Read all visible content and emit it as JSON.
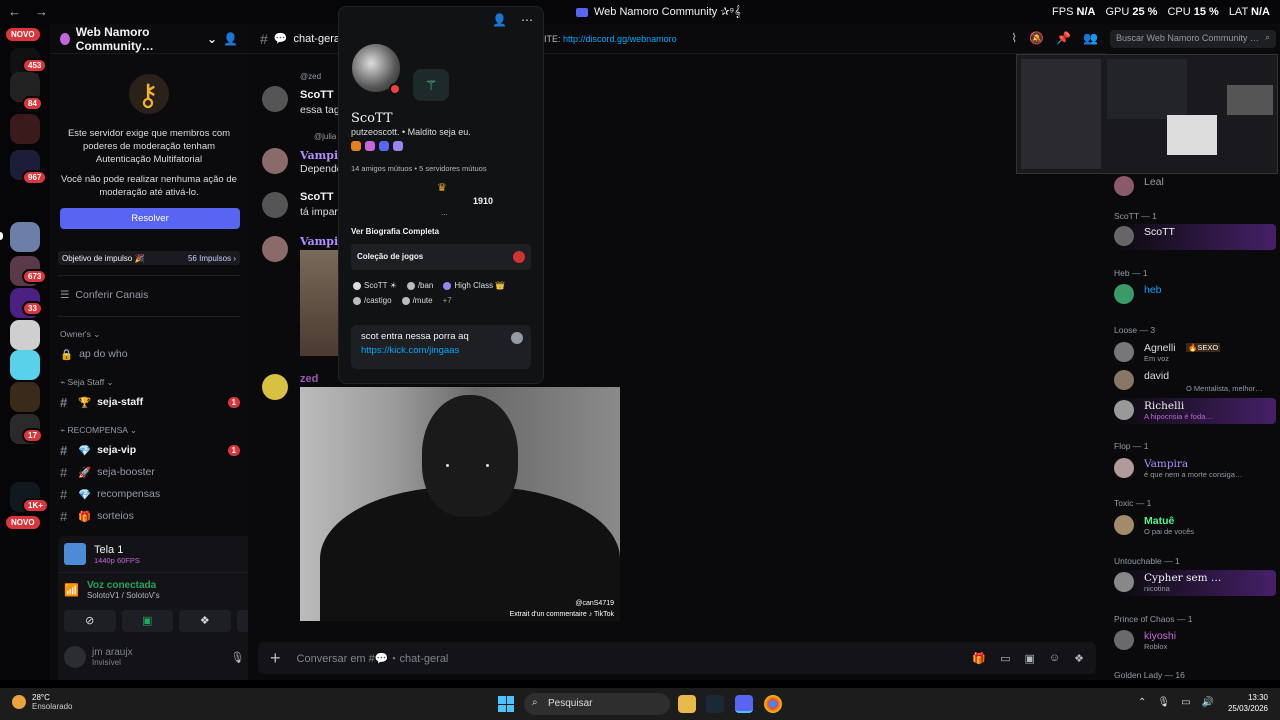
{
  "titlebar": {
    "title": "Web Namoro Community ✰⁹𝄞",
    "fps_label": "FPS",
    "fps_value": "N/A",
    "gpu_label": "GPU",
    "gpu_value": "25 %",
    "cpu_label": "CPU",
    "cpu_value": "15 %",
    "lat_label": "LAT",
    "lat_value": "N/A"
  },
  "rail": {
    "novo_top": "NOVO",
    "novo_bottom": "NOVO",
    "badges": [
      "453",
      "84",
      "967",
      "673",
      "33",
      "17",
      "1K+"
    ]
  },
  "sidebar": {
    "server_name": "Web Namoro Community…",
    "mfa_text1": "Este servidor exige que membros com poderes de moderação tenham Autenticação Multifatorial",
    "mfa_text2": "Você não pode realizar nenhuma ação de moderação até ativá-lo.",
    "resolve_label": "Resolver",
    "boost_label": "Objetivo de impulso 🎉",
    "boost_count": "56 Impulsos ›",
    "browse_channels": "Conferir Canais",
    "cat_owner": "Owner's ⌄",
    "ch_apdowho": "ap do who",
    "cat_staff": "⌁ Seja Staff ⌄",
    "ch_seja_staff": "seja-staff",
    "ch_seja_staff_badge": "1",
    "cat_recompensa": "⌁ RECOMPENSA ⌄",
    "ch_seja_vip": "seja-vip",
    "ch_seja_vip_badge": "1",
    "ch_seja_booster": "seja-booster",
    "ch_recompensas": "recompensas",
    "ch_sorteios": "sorteios"
  },
  "userpanel": {
    "stream_title": "Tela 1",
    "stream_quality": "1440p 60FPS",
    "voice_status": "Voz conectada",
    "voice_channel": "SolotoV1 / SolotoV's",
    "user_name": "jm araujx",
    "user_status": "Invisível"
  },
  "chat": {
    "channel_name": "chat-geral",
    "invite_prefix": "VITE:",
    "invite_link": "http://discord.gg/webnamoro",
    "messages": [
      {
        "reply": "@zed",
        "name": "ScoTT",
        "text": "essa tag"
      },
      {
        "reply": "@julia",
        "name": "Vampira",
        "text": "Depende"
      },
      {
        "name": "ScoTT",
        "text": "tá impar"
      },
      {
        "name": "Vampira",
        "text": ""
      },
      {
        "name": "zed",
        "text": ""
      }
    ],
    "video_watermark": "@canS4719",
    "video_credit": "Extrait d'un commentaire ♪ TikTok",
    "composer_placeholder": "Conversar em #💬・chat-geral"
  },
  "profile": {
    "display_name": "ScoTT",
    "username_line": "putzeoscott. • Maldito seja eu.",
    "mutual": "14 amigos mútuos • 5 servidores mútuos",
    "score": "1910",
    "dots": "...",
    "bio_link": "Ver Biografia Completa",
    "games_label": "Coleção de jogos",
    "roles": [
      "ScoTT ☀",
      "/ban",
      "High Class 👑",
      "/castigo",
      "/mute"
    ],
    "roles_more": "+7",
    "note_line1": "scot entra nessa porra aq",
    "note_line2": "https://kick.com/jingaas"
  },
  "members": {
    "search_placeholder": "Buscar Web Namoro Community …",
    "list": [
      {
        "cat": "",
        "name": "Leal",
        "status": "",
        "color": "#949ba4"
      },
      {
        "cat": "ScoTT — 1",
        "name": "ScoTT",
        "status": "",
        "color": "#f2f3f5"
      },
      {
        "cat": "Heb — 1",
        "name": "heb",
        "status": "",
        "color": "#00a8fc"
      },
      {
        "cat": "Loose — 3",
        "name": "Agnelli",
        "status": "Em voz",
        "color": "#dbdee1"
      },
      {
        "cat": "",
        "name": "david",
        "status": "O Mentalista, melhor…",
        "color": "#dbdee1"
      },
      {
        "cat": "",
        "name": "Richelli",
        "status": "A hipocrisia é foda…",
        "color": "#f2f3f5"
      },
      {
        "cat": "Flop — 1",
        "name": "Vampira",
        "status": "é que nem a morte consiga…",
        "color": "#b38cff"
      },
      {
        "cat": "Toxic — 1",
        "name": "Matuê",
        "status": "O pai de vocês",
        "color": "#57f287"
      },
      {
        "cat": "Untouchable — 1",
        "name": "Cypher sem …",
        "status": "nicotina",
        "color": "#f2f3f5"
      },
      {
        "cat": "Prince of Chaos — 1",
        "name": "kiyoshi",
        "status": "Roblox",
        "color": "#c266d8"
      },
      {
        "cat": "Golden Lady — 16",
        "name": "",
        "status": "",
        "color": "#f2f3f5"
      }
    ],
    "agnelli_tag": "🔥SEXO"
  },
  "taskbar": {
    "temp": "28°C",
    "weather": "Ensolarado",
    "search": "Pesquisar",
    "time": "13:30",
    "date": "25/03/2026"
  }
}
